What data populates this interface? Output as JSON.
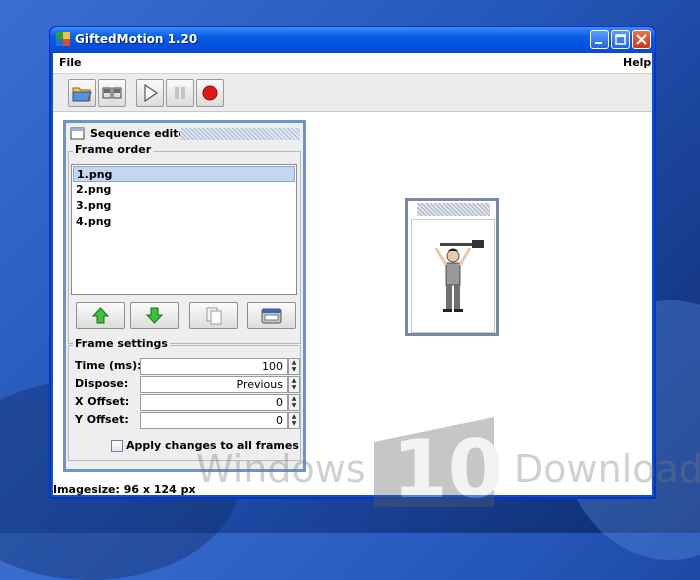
{
  "window": {
    "title": "GiftedMotion 1.20"
  },
  "menubar": {
    "file": "File",
    "help": "Help"
  },
  "toolbar": {
    "buttons": [
      "open-folder-icon",
      "frames-icon",
      "play-icon",
      "pause-icon",
      "record-icon"
    ]
  },
  "sequence_editor": {
    "title": "Sequence editor",
    "frame_order_label": "Frame order",
    "frames": [
      "1.png",
      "2.png",
      "3.png",
      "4.png"
    ],
    "selected_index": 0,
    "actions": [
      "move-up-icon",
      "move-down-icon",
      "copy-icon",
      "delete-icon"
    ]
  },
  "frame_settings": {
    "label": "Frame settings",
    "time_label": "Time (ms):",
    "time_value": "100",
    "dispose_label": "Dispose:",
    "dispose_value": "Previous",
    "xoffset_label": "X Offset:",
    "xoffset_value": "0",
    "yoffset_label": "Y Offset:",
    "yoffset_value": "0",
    "apply_all_label": "Apply changes to all frames",
    "apply_all_checked": false
  },
  "status": {
    "text": "Imagesize: 96 x 124 px"
  },
  "watermark": {
    "left": "Windows",
    "digits": "10",
    "right": "Download"
  },
  "colors": {
    "titlebar": "#0a5fe8",
    "panel_border": "#6f92c7",
    "accent_green": "#2fb12f",
    "record_red": "#e11818"
  }
}
